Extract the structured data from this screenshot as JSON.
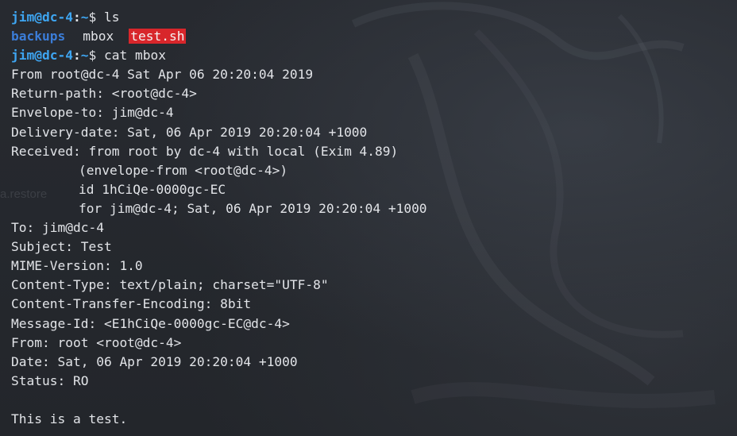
{
  "wallpaper": {
    "ghost_text": "a.restore"
  },
  "prompt1": {
    "user_host": "jim@dc-4",
    "sep": ":",
    "path": "~",
    "dollar": "$ ",
    "command": "ls"
  },
  "ls_output": {
    "dir": "backups",
    "file": "mbox",
    "exec": "test.sh"
  },
  "prompt2": {
    "user_host": "jim@dc-4",
    "sep": ":",
    "path": "~",
    "dollar": "$ ",
    "command": "cat mbox"
  },
  "mbox": {
    "lines": [
      "From root@dc-4 Sat Apr 06 20:20:04 2019",
      "Return-path: <root@dc-4>",
      "Envelope-to: jim@dc-4",
      "Delivery-date: Sat, 06 Apr 2019 20:20:04 +1000",
      "Received: from root by dc-4 with local (Exim 4.89)",
      "(envelope-from <root@dc-4>)",
      "id 1hCiQe-0000gc-EC",
      "for jim@dc-4; Sat, 06 Apr 2019 20:20:04 +1000",
      "To: jim@dc-4",
      "Subject: Test",
      "MIME-Version: 1.0",
      "Content-Type: text/plain; charset=\"UTF-8\"",
      "Content-Transfer-Encoding: 8bit",
      "Message-Id: <E1hCiQe-0000gc-EC@dc-4>",
      "From: root <root@dc-4>",
      "Date: Sat, 06 Apr 2019 20:20:04 +1000",
      "Status: RO",
      "",
      "This is a test."
    ]
  },
  "colors": {
    "background": "#24272d",
    "text": "#e2e4e8",
    "prompt": "#3ea6f2",
    "directory": "#3b7dd8",
    "executable_bg": "#d8262b"
  }
}
